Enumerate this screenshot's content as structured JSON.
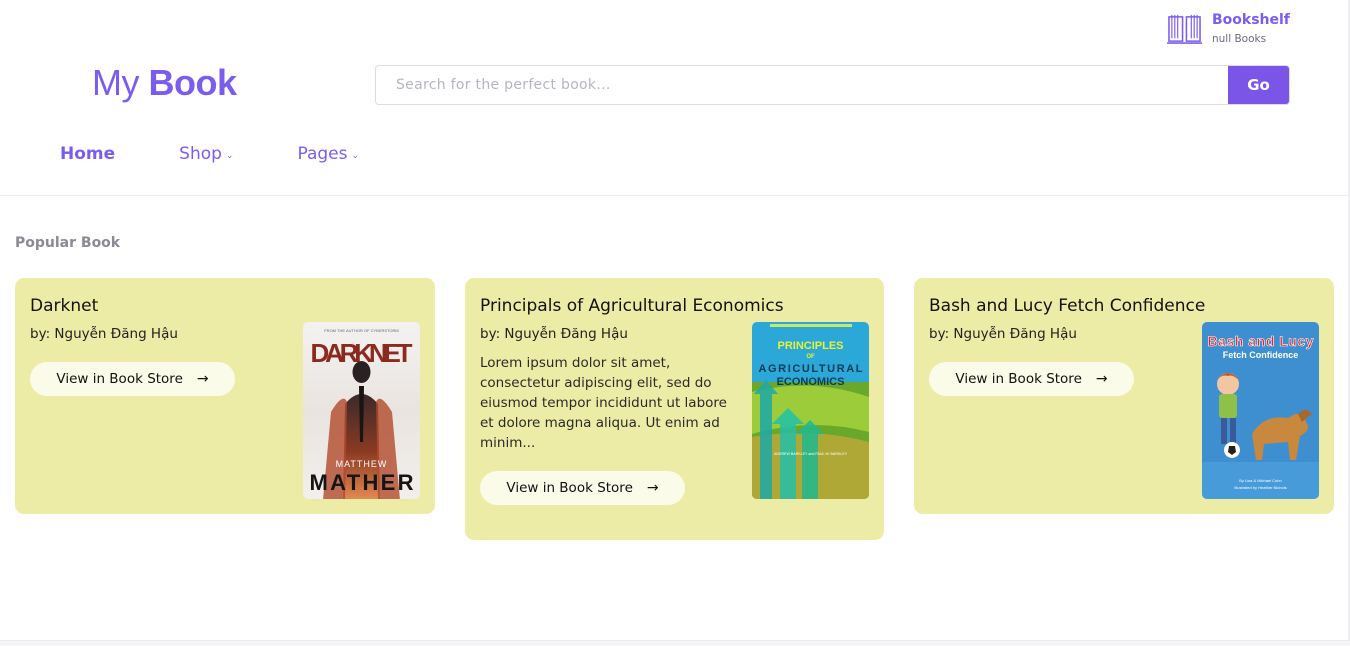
{
  "header": {
    "bookshelf": {
      "title": "Bookshelf",
      "count_text": "null Books"
    },
    "logo": {
      "part1": "My",
      "part2": "Book"
    },
    "search": {
      "placeholder": "Search for the perfect book...",
      "button": "Go"
    },
    "nav": [
      {
        "label": "Home",
        "active": true,
        "has_dropdown": false
      },
      {
        "label": "Shop",
        "active": false,
        "has_dropdown": true
      },
      {
        "label": "Pages",
        "active": false,
        "has_dropdown": true
      }
    ]
  },
  "section_title": "Popular Book",
  "books": [
    {
      "title": "Darknet",
      "author": "by: Nguyễn Đăng Hậu",
      "description": "",
      "button": "View in Book Store",
      "cover": {
        "top_line": "FROM THE AUTHOR OF CYBERSTORM",
        "word": "DARKNET",
        "author_first": "MATTHEW",
        "author_last": "MATHER"
      }
    },
    {
      "title": "Principals of Agricultural Economics",
      "author": "by: Nguyễn Đăng Hậu",
      "description": "Lorem ipsum dolor sit amet, consectetur adipiscing elit, sed do eiusmod tempor incididunt ut labore et dolore magna aliqua. Ut enim ad minim...",
      "button": "View in Book Store",
      "cover": {
        "line1": "PRINCIPLES",
        "line2": "OF",
        "line3": "AGRICULTURAL",
        "line4": "ECONOMICS",
        "authors": "ANDREW BARKLEY and PAUL W. BARKLEY"
      }
    },
    {
      "title": "Bash and Lucy Fetch Confidence",
      "author": "by: Nguyễn Đăng Hậu",
      "description": "",
      "button": "View in Book Store",
      "cover": {
        "title": "Bash and Lucy",
        "subtitle": "Fetch Confidence",
        "credit1": "By Lisa & Michael Cohn",
        "credit2": "Illustrated by Heather Nichols"
      }
    }
  ],
  "colors": {
    "accent": "#7a5cf0",
    "card_bg": "#ececa6",
    "button_bg": "#fbfbe9"
  }
}
